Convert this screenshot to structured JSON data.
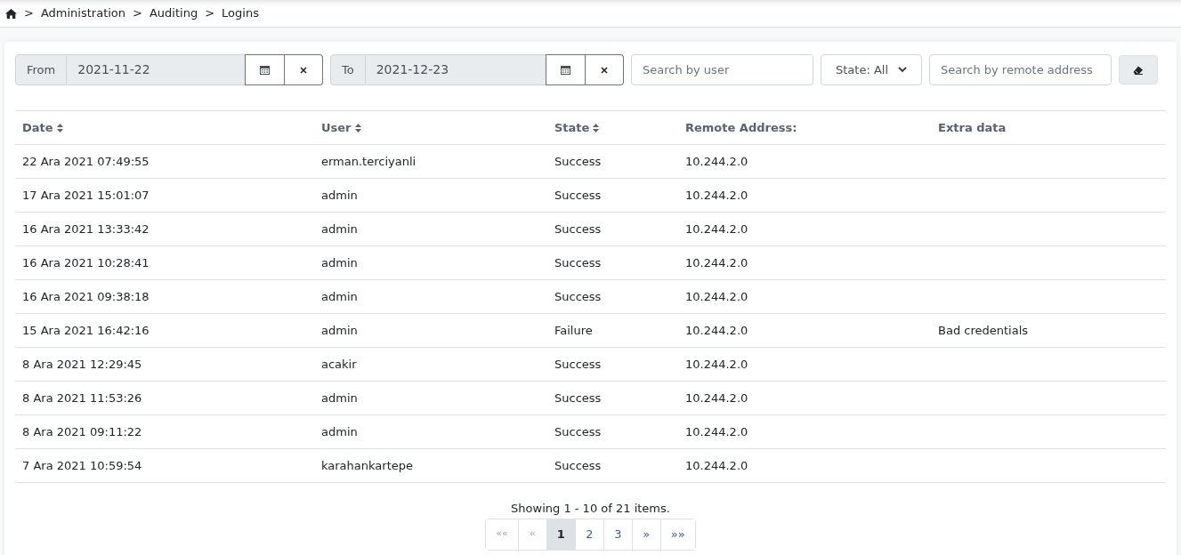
{
  "breadcrumb": [
    {
      "separator": ">",
      "label": "Administration"
    },
    {
      "separator": ">",
      "label": "Auditing"
    },
    {
      "separator": ">",
      "label": "Logins"
    }
  ],
  "filters": {
    "from": {
      "label": "From",
      "value": "2021-11-22"
    },
    "to": {
      "label": "To",
      "value": "2021-12-23"
    },
    "user_search": {
      "placeholder": "Search by user"
    },
    "state_select": {
      "value": "State: All"
    },
    "remote_search": {
      "placeholder": "Search by remote address"
    }
  },
  "table": {
    "columns": [
      {
        "label": "Date",
        "sortable": true
      },
      {
        "label": "User",
        "sortable": true
      },
      {
        "label": "State",
        "sortable": true
      },
      {
        "label": "Remote Address:",
        "sortable": false
      },
      {
        "label": "Extra data",
        "sortable": false
      }
    ],
    "rows": [
      [
        "22 Ara 2021 07:49:55",
        "erman.terciyanli",
        "Success",
        "10.244.2.0",
        ""
      ],
      [
        "17 Ara 2021 15:01:07",
        "admin",
        "Success",
        "10.244.2.0",
        ""
      ],
      [
        "16 Ara 2021 13:33:42",
        "admin",
        "Success",
        "10.244.2.0",
        ""
      ],
      [
        "16 Ara 2021 10:28:41",
        "admin",
        "Success",
        "10.244.2.0",
        ""
      ],
      [
        "16 Ara 2021 09:38:18",
        "admin",
        "Success",
        "10.244.2.0",
        ""
      ],
      [
        "15 Ara 2021 16:42:16",
        "admin",
        "Failure",
        "10.244.2.0",
        "Bad credentials"
      ],
      [
        "8 Ara 2021 12:29:45",
        "acakir",
        "Success",
        "10.244.2.0",
        ""
      ],
      [
        "8 Ara 2021 11:53:26",
        "admin",
        "Success",
        "10.244.2.0",
        ""
      ],
      [
        "8 Ara 2021 09:11:22",
        "admin",
        "Success",
        "10.244.2.0",
        ""
      ],
      [
        "7 Ara 2021 10:59:54",
        "karahankartepe",
        "Success",
        "10.244.2.0",
        ""
      ]
    ]
  },
  "summary": "Showing 1 - 10 of 21 items.",
  "pagination": [
    {
      "label": "««",
      "selected": false,
      "disabled": true
    },
    {
      "label": "«",
      "selected": false,
      "disabled": true
    },
    {
      "label": "1",
      "selected": true,
      "disabled": false
    },
    {
      "label": "2",
      "selected": false,
      "disabled": false
    },
    {
      "label": "3",
      "selected": false,
      "disabled": false
    },
    {
      "label": "»",
      "selected": false,
      "disabled": false
    },
    {
      "label": "»»",
      "selected": false,
      "disabled": false
    }
  ]
}
